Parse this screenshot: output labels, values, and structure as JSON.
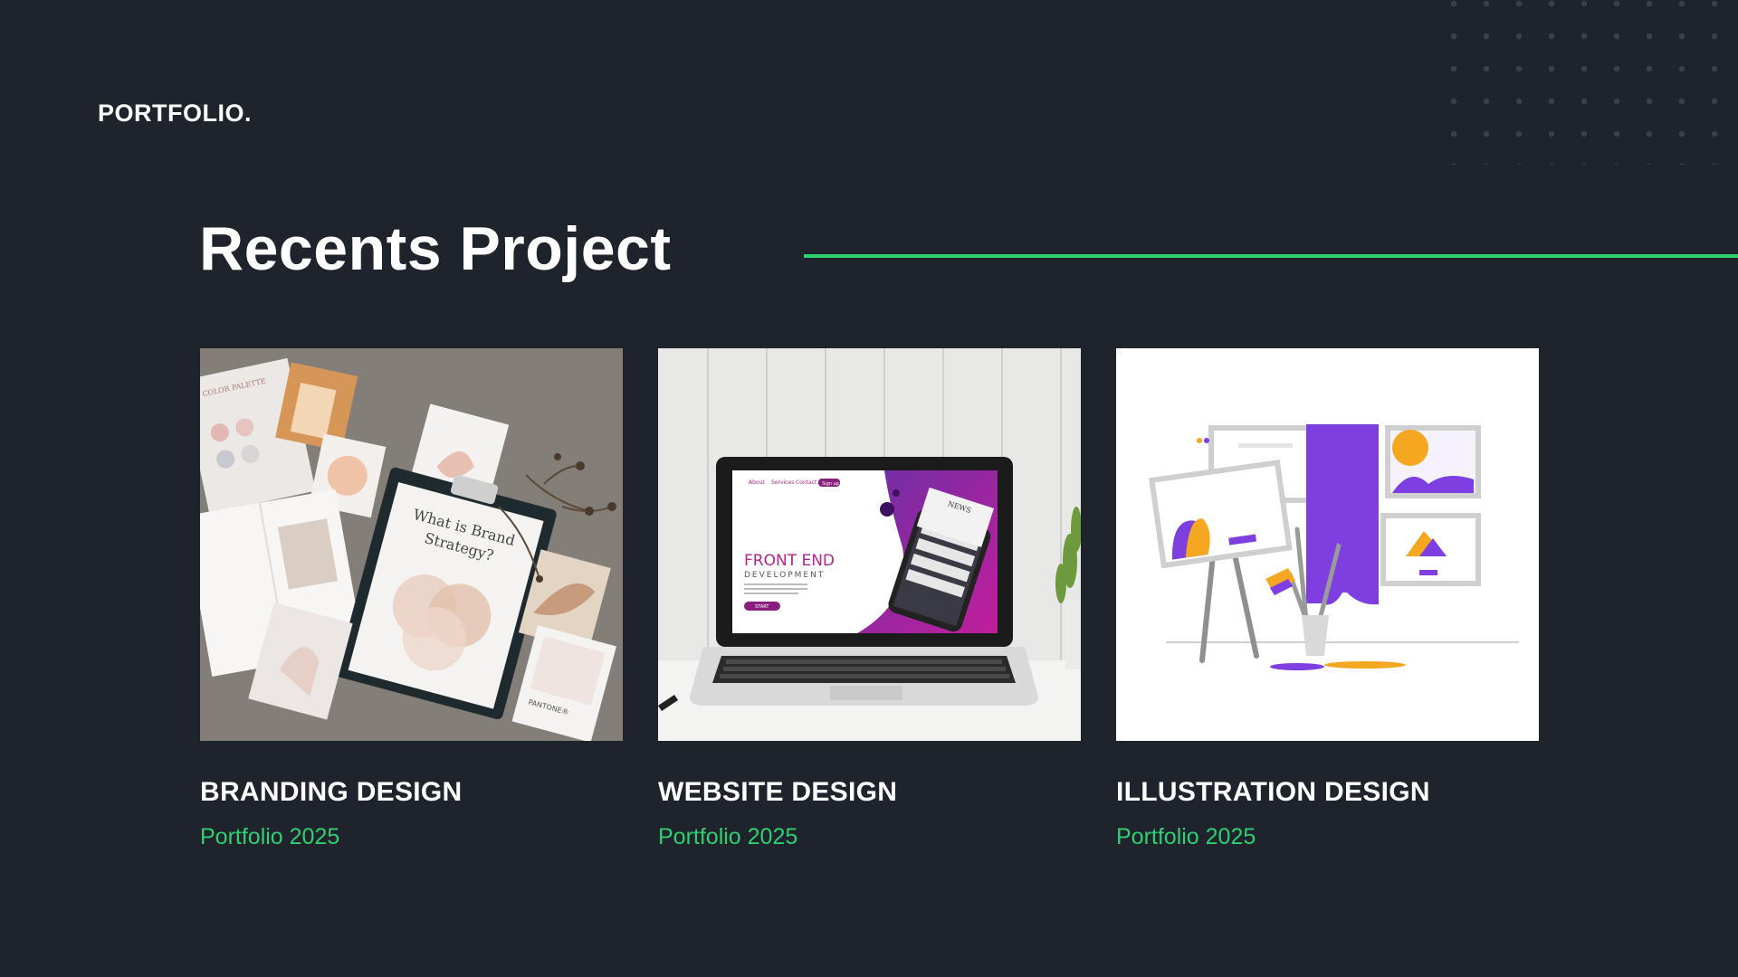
{
  "header": {
    "brand": "PORTFOLIO."
  },
  "section": {
    "title": "Recents Project"
  },
  "colors": {
    "background": "#1f232b",
    "accent": "#2fcf72",
    "text": "#ffffff"
  },
  "projects": [
    {
      "title": "BRANDING DESIGN",
      "subtitle": "Portfolio 2025",
      "image": "branding-mockup-image",
      "image_text": {
        "clipboard_line1": "What is Brand",
        "clipboard_line2": "Strategy?",
        "swatch": "PANTONE®",
        "card": "COLOR PALETTE"
      }
    },
    {
      "title": "WEBSITE DESIGN",
      "subtitle": "Portfolio 2025",
      "image": "laptop-website-image",
      "image_text": {
        "nav": [
          "About",
          "Services",
          "Contact",
          "Sign up"
        ],
        "headline_line1": "FRONT END",
        "headline_line2": "DEVELOPMENT",
        "cta": "START",
        "phone_label": "NEWS"
      }
    },
    {
      "title": "ILLUSTRATION DESIGN",
      "subtitle": "Portfolio 2025",
      "image": "art-studio-illustration"
    }
  ]
}
